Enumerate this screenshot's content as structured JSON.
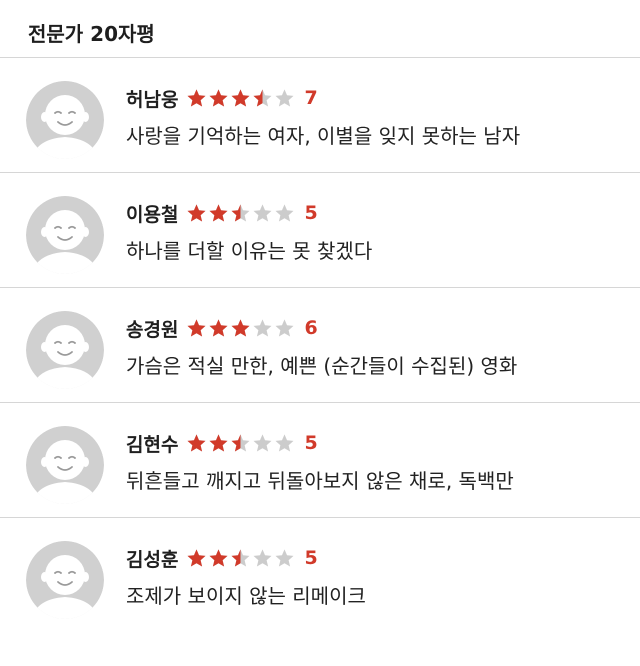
{
  "header": {
    "title": "전문가 20자평"
  },
  "colors": {
    "star_filled": "#d13a2a",
    "star_empty": "#cccccc",
    "score": "#d13a2a",
    "avatar_bg": "#d0d0d0"
  },
  "reviews": [
    {
      "name": "허남웅",
      "rating_stars": 3.5,
      "score": "7",
      "comment": "사랑을 기억하는 여자, 이별을 잊지 못하는 남자"
    },
    {
      "name": "이용철",
      "rating_stars": 2.5,
      "score": "5",
      "comment": "하나를 더할 이유는 못 찾겠다"
    },
    {
      "name": "송경원",
      "rating_stars": 3,
      "score": "6",
      "comment": "가슴은 적실 만한, 예쁜 (순간들이 수집된) 영화"
    },
    {
      "name": "김현수",
      "rating_stars": 2.5,
      "score": "5",
      "comment": "뒤흔들고 깨지고 뒤돌아보지 않은 채로, 독백만"
    },
    {
      "name": "김성훈",
      "rating_stars": 2.5,
      "score": "5",
      "comment": "조제가 보이지 않는 리메이크"
    }
  ]
}
